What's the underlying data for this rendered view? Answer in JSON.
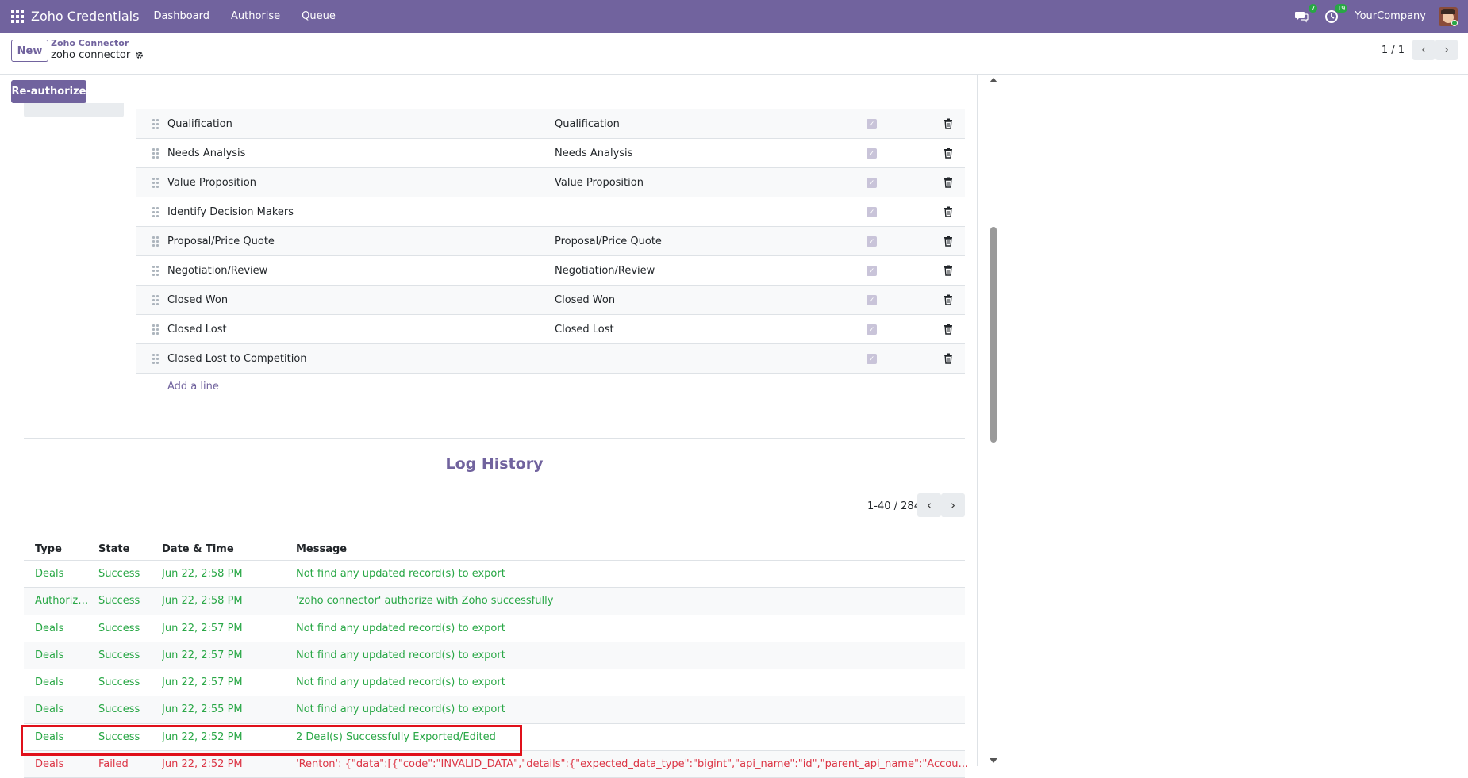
{
  "topbar": {
    "app_name": "Zoho Credentials",
    "menu": [
      "Dashboard",
      "Authorise",
      "Queue"
    ],
    "messages_count": "7",
    "activities_count": "19",
    "company": "YourCompany"
  },
  "control_panel": {
    "new_label": "New",
    "breadcrumb_parent": "Zoho Connector",
    "breadcrumb_current": "zoho connector",
    "pager": "1 / 1"
  },
  "form": {
    "reauthorize_label": "Re-authorize"
  },
  "stages": {
    "rows": [
      {
        "zoho": "Qualification",
        "odoo": "Qualification",
        "active": true
      },
      {
        "zoho": "Needs Analysis",
        "odoo": "Needs Analysis",
        "active": true
      },
      {
        "zoho": "Value Proposition",
        "odoo": "Value Proposition",
        "active": true
      },
      {
        "zoho": "Identify Decision Makers",
        "odoo": "",
        "active": true
      },
      {
        "zoho": "Proposal/Price Quote",
        "odoo": "Proposal/Price Quote",
        "active": true
      },
      {
        "zoho": "Negotiation/Review",
        "odoo": "Negotiation/Review",
        "active": true
      },
      {
        "zoho": "Closed Won",
        "odoo": "Closed Won",
        "active": true
      },
      {
        "zoho": "Closed Lost",
        "odoo": "Closed Lost",
        "active": true
      },
      {
        "zoho": "Closed Lost to Competition",
        "odoo": "",
        "active": true
      }
    ],
    "add_line_label": "Add a line"
  },
  "log_history": {
    "title": "Log History",
    "pager": "1-40 / 284",
    "columns": [
      "Type",
      "State",
      "Date & Time",
      "Message"
    ],
    "rows": [
      {
        "type": "Deals",
        "state": "Success",
        "date": "Jun 22, 2:58 PM",
        "message": "Not find any updated record(s) to export"
      },
      {
        "type": "Authoriza...",
        "state": "Success",
        "date": "Jun 22, 2:58 PM",
        "message": "'zoho connector' authorize with Zoho successfully"
      },
      {
        "type": "Deals",
        "state": "Success",
        "date": "Jun 22, 2:57 PM",
        "message": "Not find any updated record(s) to export"
      },
      {
        "type": "Deals",
        "state": "Success",
        "date": "Jun 22, 2:57 PM",
        "message": "Not find any updated record(s) to export"
      },
      {
        "type": "Deals",
        "state": "Success",
        "date": "Jun 22, 2:57 PM",
        "message": "Not find any updated record(s) to export"
      },
      {
        "type": "Deals",
        "state": "Success",
        "date": "Jun 22, 2:55 PM",
        "message": "Not find any updated record(s) to export"
      },
      {
        "type": "Deals",
        "state": "Success",
        "date": "Jun 22, 2:52 PM",
        "message": "2 Deal(s) Successfully Exported/Edited"
      },
      {
        "type": "Deals",
        "state": "Failed",
        "date": "Jun 22, 2:52 PM",
        "message": "'Renton': {\"data\":[{\"code\":\"INVALID_DATA\",\"details\":{\"expected_data_type\":\"bigint\",\"api_name\":\"id\",\"parent_api_name\":\"Account_Name\"},\"mes"
      }
    ]
  },
  "colors": {
    "brand": "#71639e",
    "success": "#28a745",
    "failed": "#dc3545",
    "highlight": "#e0101a"
  }
}
